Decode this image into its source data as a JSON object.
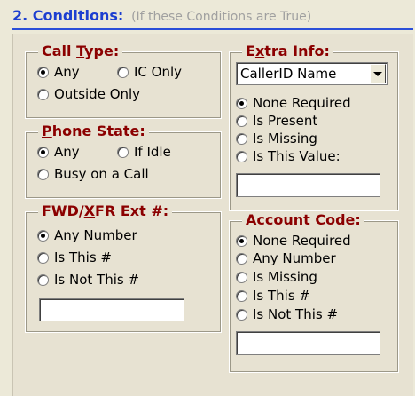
{
  "header": {
    "title": "2. Conditions:",
    "subtitle": "(If these Conditions are True)"
  },
  "call_type": {
    "legend_pre": "Call ",
    "legend_u": "T",
    "legend_post": "ype:",
    "options": [
      "Any",
      "IC Only",
      "Outside Only"
    ],
    "selected": "Any"
  },
  "phone_state": {
    "legend_u": "P",
    "legend_post": "hone State:",
    "options": [
      "Any",
      "If Idle",
      "Busy on a Call"
    ],
    "selected": "Any"
  },
  "fwd_xfr": {
    "legend_pre": "FWD/",
    "legend_u": "X",
    "legend_post": "FR Ext #:",
    "options": [
      "Any Number",
      "Is This #",
      "Is Not This #"
    ],
    "selected": "Any Number",
    "value": ""
  },
  "extra_info": {
    "legend_pre": "E",
    "legend_u": "x",
    "legend_post": "tra Info:",
    "dropdown_value": "CallerID Name",
    "options": [
      "None Required",
      "Is Present",
      "Is Missing",
      "Is This Value:"
    ],
    "selected": "None Required",
    "value": ""
  },
  "account_code": {
    "legend_pre": "Acc",
    "legend_u": "o",
    "legend_post": "unt Code:",
    "options": [
      "None Required",
      "Any Number",
      "Is Missing",
      "Is This #",
      "Is Not This #"
    ],
    "selected": "None Required",
    "value": ""
  },
  "icons": [
    "radio-selected-icon",
    "radio-unselected-icon",
    "dropdown-arrow-icon"
  ]
}
